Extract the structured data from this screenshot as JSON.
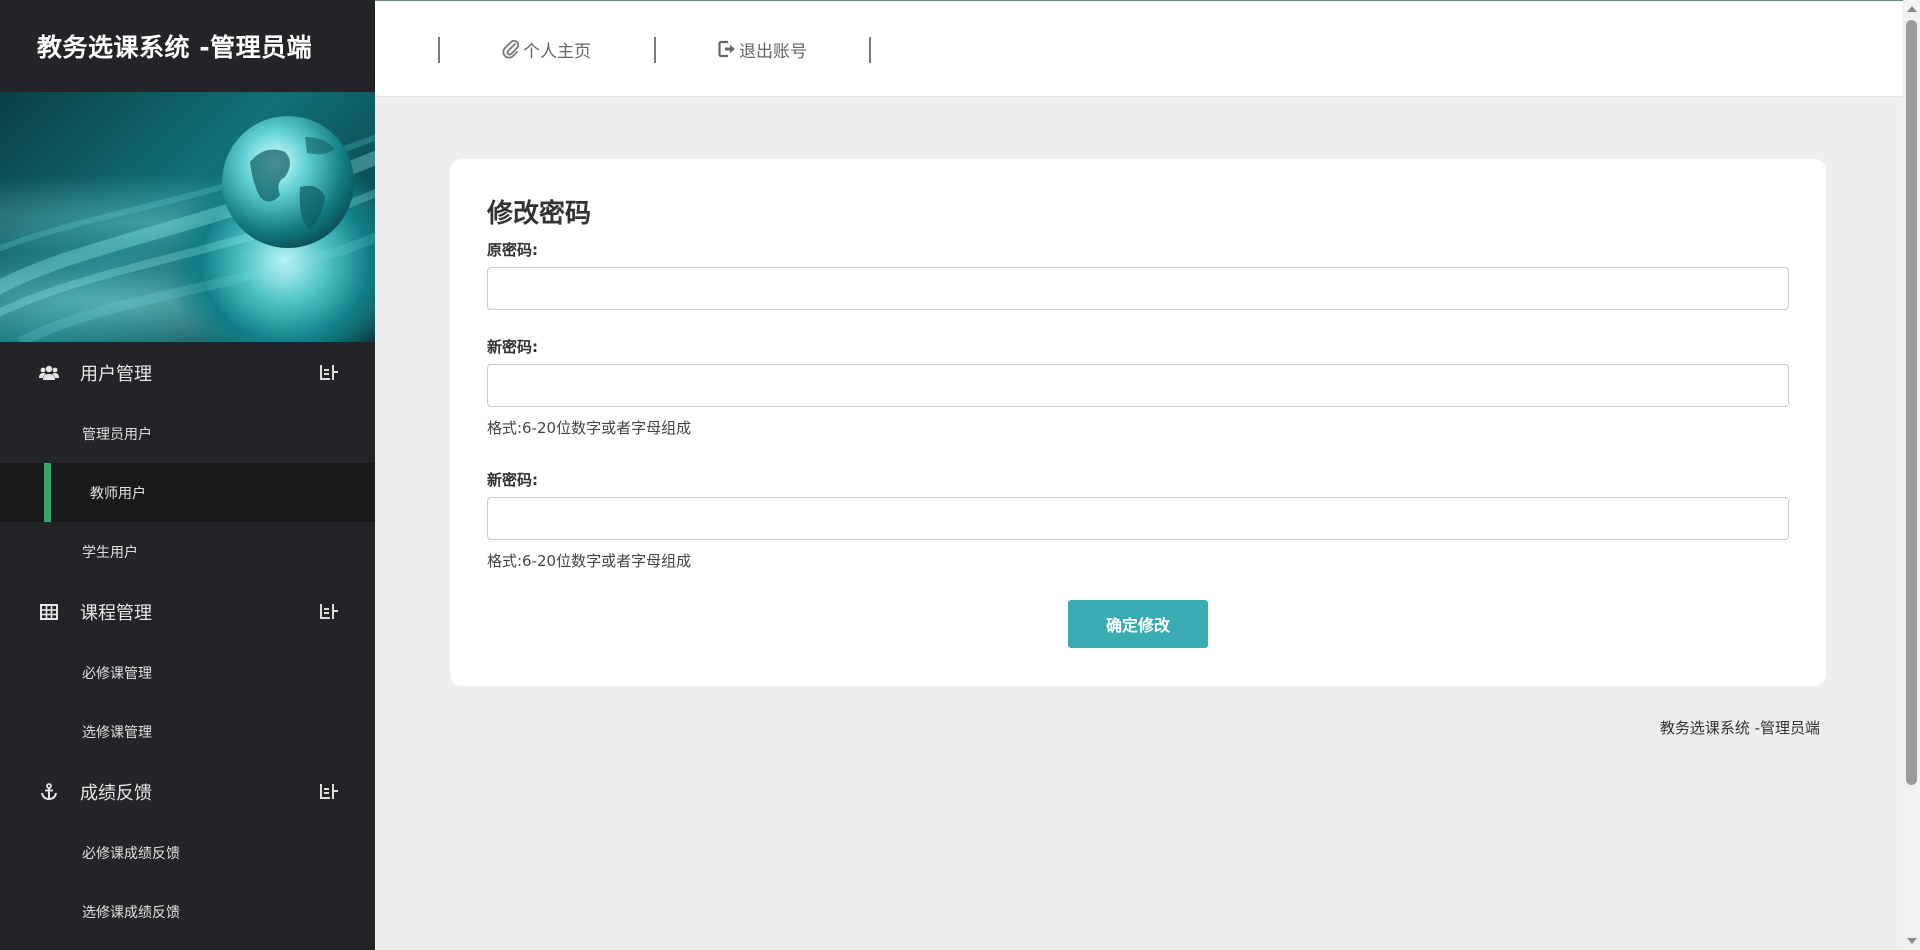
{
  "sidebar": {
    "brand": "教务选课系统 -管理员端",
    "groups": [
      {
        "label": "用户管理",
        "icon": "users-icon",
        "items": [
          {
            "label": "管理员用户",
            "active": false
          },
          {
            "label": "教师用户",
            "active": true
          },
          {
            "label": "学生用户",
            "active": false
          }
        ]
      },
      {
        "label": "课程管理",
        "icon": "table-icon",
        "items": [
          {
            "label": "必修课管理",
            "active": false
          },
          {
            "label": "选修课管理",
            "active": false
          }
        ]
      },
      {
        "label": "成绩反馈",
        "icon": "anchor-icon",
        "items": [
          {
            "label": "必修课成绩反馈",
            "active": false
          },
          {
            "label": "选修课成绩反馈",
            "active": false
          }
        ]
      }
    ]
  },
  "header": {
    "profile_label": "个人主页",
    "logout_label": "退出账号"
  },
  "form": {
    "title": "修改密码",
    "old_password_label": "原密码:",
    "new_password_label": "新密码:",
    "confirm_password_label": "新密码:",
    "hint": "格式:6-20位数字或者字母组成",
    "old_password_value": "",
    "new_password_value": "",
    "confirm_password_value": "",
    "submit_label": "确定修改"
  },
  "footer": {
    "text": "教务选课系统 -管理员端"
  },
  "colors": {
    "sidebar_bg": "#222427",
    "active_indicator": "#3aa46e",
    "primary_button": "#3aabb3",
    "page_bg": "#eeeeee"
  }
}
